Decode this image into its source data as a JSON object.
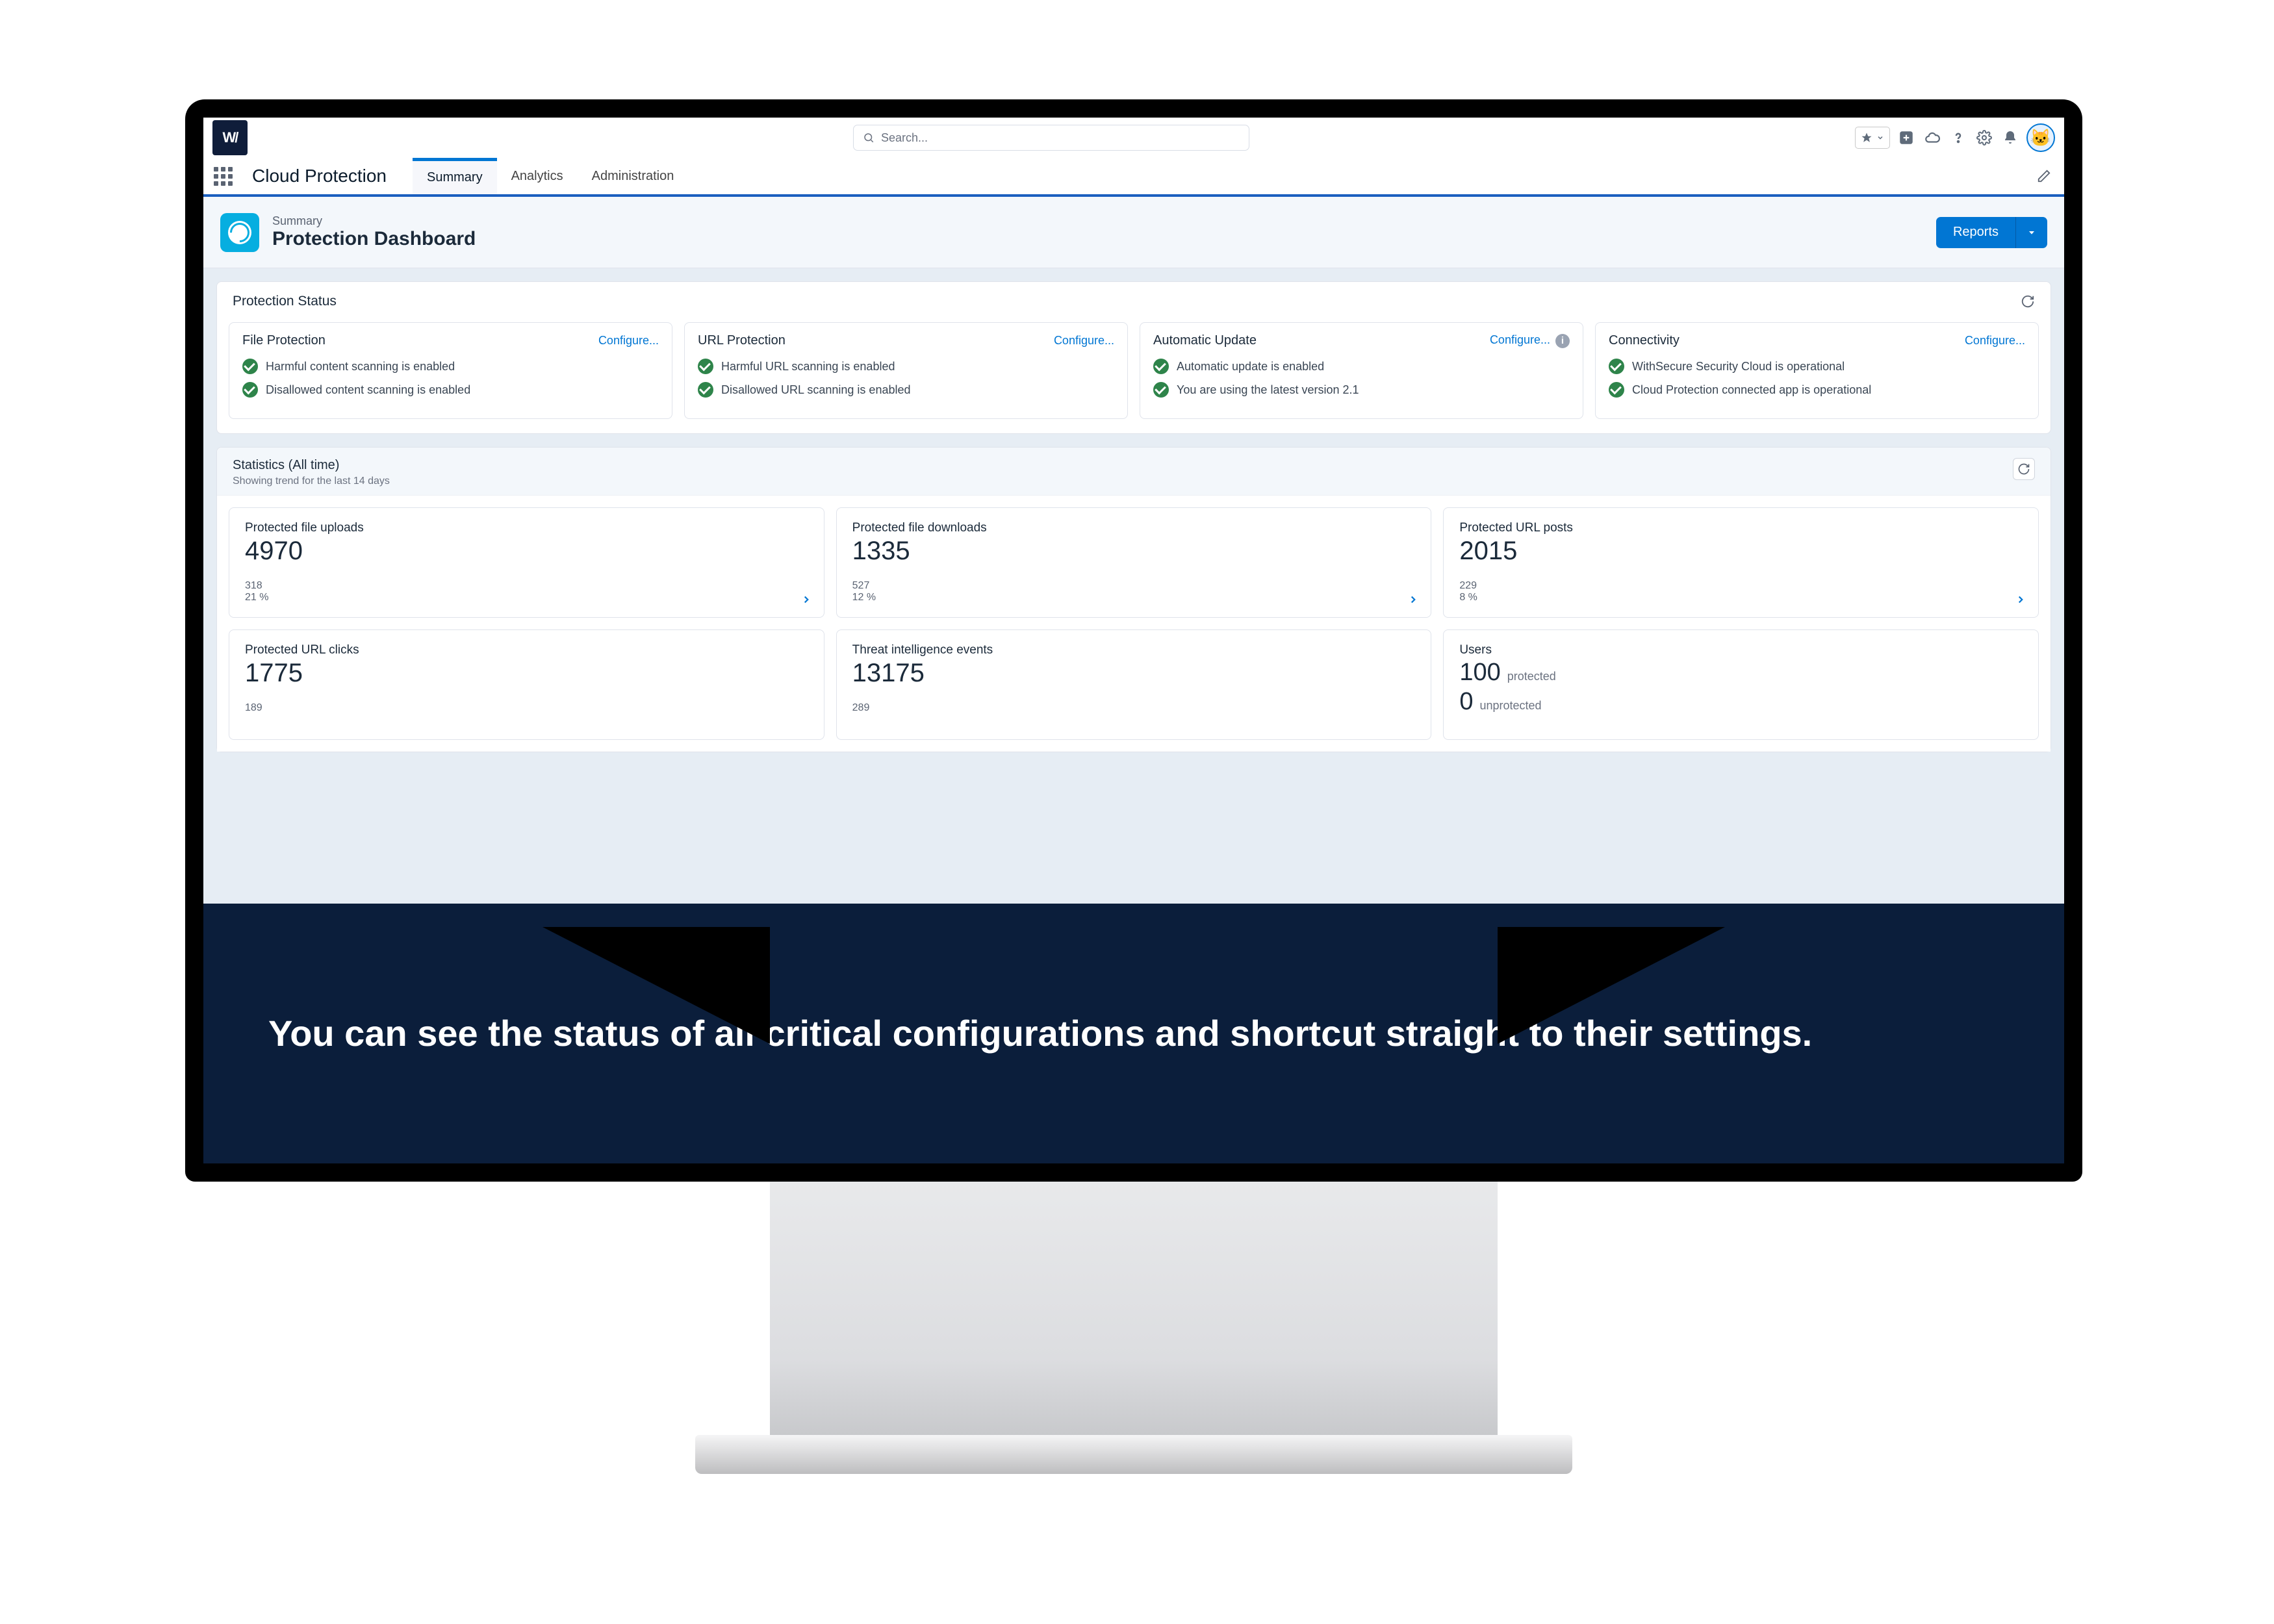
{
  "top": {
    "search_placeholder": "Search..."
  },
  "nav": {
    "app_name": "Cloud Protection",
    "tabs": [
      "Summary",
      "Analytics",
      "Administration"
    ]
  },
  "page_header": {
    "eyebrow": "Summary",
    "title": "Protection Dashboard",
    "reports_label": "Reports"
  },
  "protection_status": {
    "title": "Protection Status",
    "configure_label": "Configure...",
    "cards": [
      {
        "name": "file-protection",
        "title": "File Protection",
        "lines": [
          "Harmful content scanning is enabled",
          "Disallowed content scanning is enabled"
        ]
      },
      {
        "name": "url-protection",
        "title": "URL Protection",
        "lines": [
          "Harmful URL scanning is enabled",
          "Disallowed URL scanning is enabled"
        ]
      },
      {
        "name": "automatic-update",
        "title": "Automatic Update",
        "has_info": true,
        "lines": [
          "Automatic update is enabled",
          "You are using the latest version 2.1"
        ]
      },
      {
        "name": "connectivity",
        "title": "Connectivity",
        "lines": [
          "WithSecure Security Cloud is operational",
          "Cloud Protection connected app is operational"
        ]
      }
    ]
  },
  "statistics": {
    "title": "Statistics (All time)",
    "subtitle": "Showing trend for the last 14 days",
    "cards": [
      {
        "label": "Protected file uploads",
        "value": "4970",
        "sub1": "318",
        "sub2": "21 %",
        "chevron": true
      },
      {
        "label": "Protected file downloads",
        "value": "1335",
        "sub1": "527",
        "sub2": "12 %",
        "chevron": true
      },
      {
        "label": "Protected URL posts",
        "value": "2015",
        "sub1": "229",
        "sub2": "8 %",
        "chevron": true
      },
      {
        "label": "Protected URL clicks",
        "value": "1775",
        "sub1": "189",
        "sub2": "",
        "chevron": false
      },
      {
        "label": "Threat intelligence events",
        "value": "13175",
        "sub1": "289",
        "sub2": "",
        "chevron": false
      },
      {
        "label": "Users",
        "value": "100",
        "suffix": "protected",
        "value2": "0",
        "suffix2": "unprotected",
        "users": true
      }
    ]
  },
  "caption": "You can see the status of all critical configurations and shortcut straight to their settings."
}
